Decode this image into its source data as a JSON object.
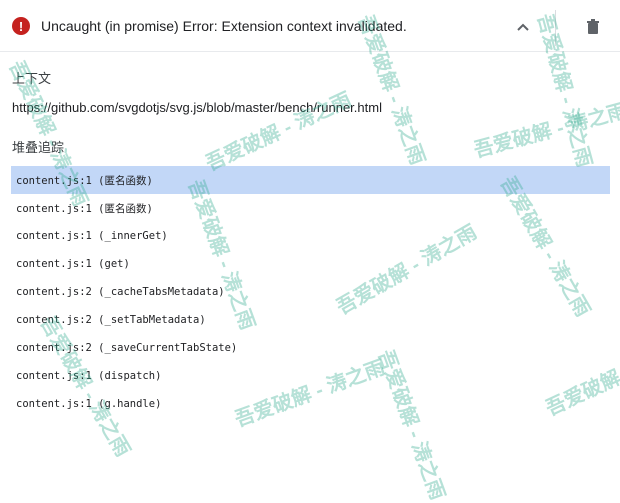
{
  "error": {
    "message": "Uncaught (in promise) Error: Extension context invalidated.",
    "icon": "error-icon",
    "color": "#c5221f"
  },
  "context": {
    "label": "上下文",
    "url": "https://github.com/svgdotjs/svg.js/blob/master/bench/runner.html"
  },
  "stack": {
    "label": "堆叠追踪",
    "selected_color": "#c2d7f7",
    "frames": [
      "content.js:1 (匿名函数)",
      "content.js:1 (匿名函数)",
      "content.js:1 (_innerGet)",
      "content.js:1 (get)",
      "content.js:2 (_cacheTabsMetadata)",
      "content.js:2 (_setTabMetadata)",
      "content.js:2 (_saveCurrentTabState)",
      "content.js:1 (dispatch)",
      "content.js:1 (g.handle)"
    ]
  },
  "watermark": {
    "text": "吾爱破解 - 涛之雨",
    "color": "#2eaa8c"
  }
}
